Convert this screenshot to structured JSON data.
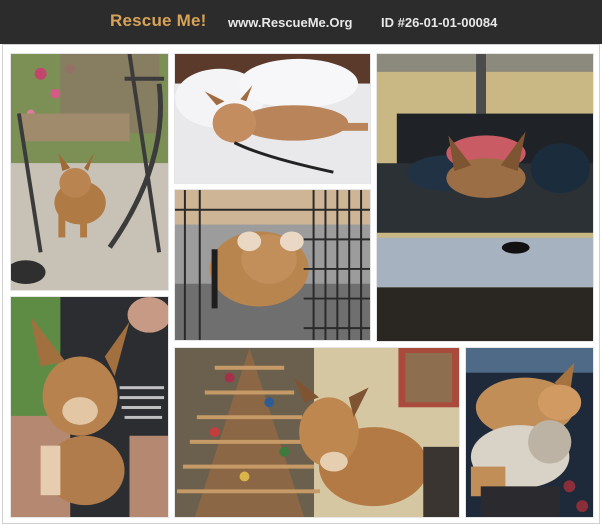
{
  "header": {
    "brand": "Rescue Me!",
    "site": "www.RescueMe.Org",
    "pet_id": "ID #26-01-01-00084"
  },
  "colors": {
    "header_bg": "#2c2c2c",
    "brand": "#d7a259",
    "header_text": "#e8e8e8"
  },
  "gallery": {
    "photos": [
      {
        "name": "photo-puppy-under-chair"
      },
      {
        "name": "photo-puppy-on-bed"
      },
      {
        "name": "photo-puppy-in-crate"
      },
      {
        "name": "photo-puppy-on-couch"
      },
      {
        "name": "photo-puppy-held"
      },
      {
        "name": "photo-dog-by-christmas-tree"
      },
      {
        "name": "photo-dog-playing-with-terrier"
      }
    ]
  }
}
